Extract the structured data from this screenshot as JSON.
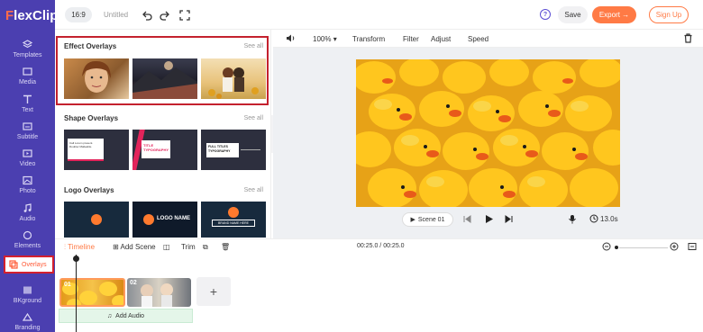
{
  "app": {
    "logo_f": "F",
    "logo_rest": "lexClip"
  },
  "sidebar": {
    "items": [
      {
        "label": "Templates",
        "icon": "templates-icon"
      },
      {
        "label": "Media",
        "icon": "media-icon"
      },
      {
        "label": "Text",
        "icon": "text-icon"
      },
      {
        "label": "Subtitle",
        "icon": "subtitle-icon"
      },
      {
        "label": "Video",
        "icon": "video-icon"
      },
      {
        "label": "Photo",
        "icon": "photo-icon"
      },
      {
        "label": "Audio",
        "icon": "audio-icon"
      },
      {
        "label": "Elements",
        "icon": "elements-icon"
      },
      {
        "label": "Overlays",
        "icon": "overlays-icon"
      },
      {
        "label": "BKground",
        "icon": "background-icon"
      },
      {
        "label": "Branding",
        "icon": "branding-icon"
      }
    ]
  },
  "topbar": {
    "ratio": "16:9",
    "title": "Untitled",
    "help": "?",
    "save": "Save",
    "export": "Export →",
    "signup": "Sign Up"
  },
  "panel": {
    "effect_title": "Effect Overlays",
    "shape_title": "Shape Overlays",
    "logo_title": "Logo Overlays",
    "see_all": "See all",
    "shape_texts": [
      "Call Lorem present. Doubter Malleable.",
      "TITLE TYPOGRAPHY",
      "FULL TITLES TYPOGRAPHY"
    ],
    "logo_texts": [
      "LOGO NAME",
      "BRAND NAME HERE"
    ]
  },
  "edit_toolbar": {
    "zoom": "100%",
    "transform": "Transform",
    "filter": "Filter",
    "adjust": "Adjust",
    "speed": "Speed"
  },
  "player": {
    "scene": "Scene 01",
    "duration": "13.0s"
  },
  "timeline": {
    "timeline_label": "Timeline",
    "add_scene": "Add Scene",
    "trim": "Trim",
    "time": "00:25.0 / 00:25.0",
    "clip1": "01",
    "clip2": "02",
    "add_audio": "Add Audio",
    "add_clip": "+"
  },
  "colors": {
    "sidebar": "#4b3fb0",
    "accent": "#ff7a45",
    "highlight": "#c4212e"
  }
}
